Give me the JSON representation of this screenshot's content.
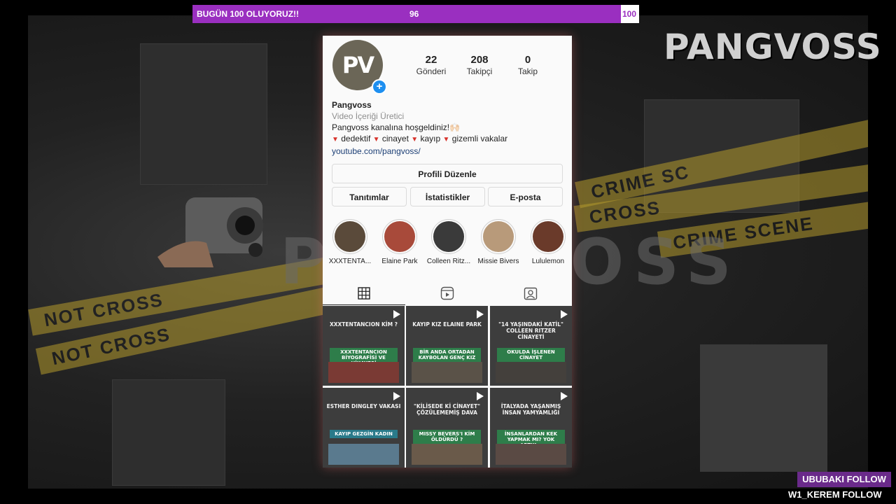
{
  "goal": {
    "title": "BUGÜN 100 OLUYORUZ!!",
    "current": "96",
    "target": "100",
    "progress_fraction": 0.96,
    "color": "#9a2fc0"
  },
  "overlay": {
    "brand": "PANGVOSS",
    "watermark": "PANGVOSS",
    "tape_texts": [
      "CRIME SC",
      "CROSS",
      "CRIME SCENE",
      "NOT CROSS",
      "NOT CROSS"
    ]
  },
  "profile": {
    "avatar_text": "PV",
    "stats": [
      {
        "value": "22",
        "label": "Gönderi"
      },
      {
        "value": "208",
        "label": "Takipçi"
      },
      {
        "value": "0",
        "label": "Takip"
      }
    ],
    "name": "Pangvoss",
    "category": "Video İçeriği Üretici",
    "welcome": "Pangvoss kanalına hoşgeldiniz!🙌🏻",
    "tags": [
      "dedektif",
      "cinayet",
      "kayıp",
      "gizemli vakalar"
    ],
    "link": "youtube.com/pangvoss/"
  },
  "buttons": {
    "edit": "Profili Düzenle",
    "promos": "Tanıtımlar",
    "insights": "İstatistikler",
    "email": "E-posta"
  },
  "highlights": [
    {
      "label": "XXXTENTA...",
      "color": "#5a4a3a"
    },
    {
      "label": "Elaine Park",
      "color": "#a84a3a"
    },
    {
      "label": "Colleen Ritz...",
      "color": "#3a3a3a"
    },
    {
      "label": "Missie Bivers",
      "color": "#b89a7a"
    },
    {
      "label": "Lululemon",
      "color": "#6a3a2a"
    }
  ],
  "tabs": [
    "grid-icon",
    "reels-icon",
    "tagged-icon"
  ],
  "posts": [
    {
      "head": "XXXTENTANCION KİM ?",
      "sub": "XXXTENTANCION BİYOGRAFİSİ VE HİKAYESİ",
      "sub_color": "#2e7d4a"
    },
    {
      "head": "KAYIP KIZ ELAINE PARK",
      "sub": "BİR ANDA ORTADAN KAYBOLAN GENÇ KIZ",
      "sub_color": "#2e7d4a"
    },
    {
      "head": "\"14 YAŞINDAKİ KATİL\" COLLEEN RITZER CİNAYETİ",
      "sub": "OKULDA İŞLENEN CİNAYET",
      "sub_color": "#2e7d4a"
    },
    {
      "head": "ESTHER DINGLEY VAKASI",
      "sub": "KAYIP GEZGİN KADIN",
      "sub_color": "#2a7a8a"
    },
    {
      "head": "\"KİLİSEDE Kİ CİNAYET\" ÇÖZÜLEMEMİŞ DAVA",
      "sub": "MISSY BEVERS'I KİM ÖLDÜRDÜ ?",
      "sub_color": "#2e7d4a"
    },
    {
      "head": "İTALYADA YAŞANMIŞ İNSAN YAMYAMLIĞI",
      "sub": "İNSANLARDAN KEK YAPMAK MI? YOK ARTIK...",
      "sub_color": "#2e7d4a"
    }
  ],
  "follows": {
    "line1": "UBUBAKI  FOLLOW",
    "line2": "W1_KEREM  FOLLOW"
  }
}
